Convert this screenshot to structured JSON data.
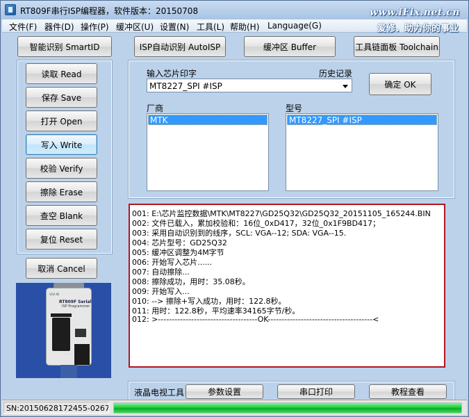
{
  "window": {
    "title": "RT809F串行ISP编程器，软件版本：20150708",
    "watermark_site": "www.iFix.net.cn",
    "watermark_slogan": "爱修．助力你的事业"
  },
  "menu": [
    "文件(F)",
    "器件(D)",
    "操作(P)",
    "缓冲区(U)",
    "设置(N)",
    "工具(L)",
    "帮助(H)",
    "Language(G)"
  ],
  "toolbar": {
    "smart_id": "智能识别 SmartID",
    "auto_isp": "ISP自动识别 AutoISP",
    "buffer": "缓冲区 Buffer",
    "toolchain": "工具链面板 Toolchain"
  },
  "actions": {
    "read": "读取 Read",
    "save": "保存 Save",
    "open": "打开 Open",
    "write": "写入 Write",
    "verify": "校验 Verify",
    "erase": "擦除 Erase",
    "blank": "查空 Blank",
    "reset": "复位 Reset",
    "cancel": "取消 Cancel"
  },
  "chip": {
    "input_label": "输入芯片印字",
    "history_label": "历史记录",
    "input_value": "MT8227_SPI #ISP",
    "ok_label": "确定 OK",
    "vendor_label": "厂商",
    "model_label": "型号",
    "vendor_selected": "MTK",
    "model_selected": "MT8227_SPI #ISP"
  },
  "device_photo": {
    "label1": "RT809F Serial",
    "label2": "ISP Programmer",
    "label3": "",
    "tag_left": "VGA IN",
    "tag_bottom": "VGA ISP"
  },
  "log": [
    "001:  E:\\芯片监控数据\\MTK\\MT8227\\GD25Q32\\GD25Q32_20151105_165244.BIN",
    "002:  文件已载入，累加校验和：16位_0xD417，32位_0x1F9BD417；",
    "003:  采用自动识别到的线序，SCL: VGA--12; SDA: VGA--15.",
    "004:  芯片型号：GD25Q32",
    "005:  缓冲区调整为4M字节",
    "006:  开始写入芯片......",
    "007:  自动擦除...",
    "008:  擦除成功，用时：35.08秒。",
    "009:  开始写入...",
    "010:  --> 擦除+写入成功，用时：122.8秒。",
    "011:  用时：122.8秒，平均速率34165字节/秒。",
    "012:  >------------------------------------OK--------------------------------------<"
  ],
  "bottom_tools": {
    "lcd_label": "液晶电视工具",
    "params": "参数设置",
    "serial_print": "串口打印",
    "tutorial": "教程查看"
  },
  "status": {
    "sn": "SN:20150628172455-0267",
    "progress": 1.0
  },
  "colors": {
    "log_border": "#b4141e",
    "selection": "#3399ff",
    "progress": "#06b026",
    "photo_bg": "#2a4fa6"
  }
}
